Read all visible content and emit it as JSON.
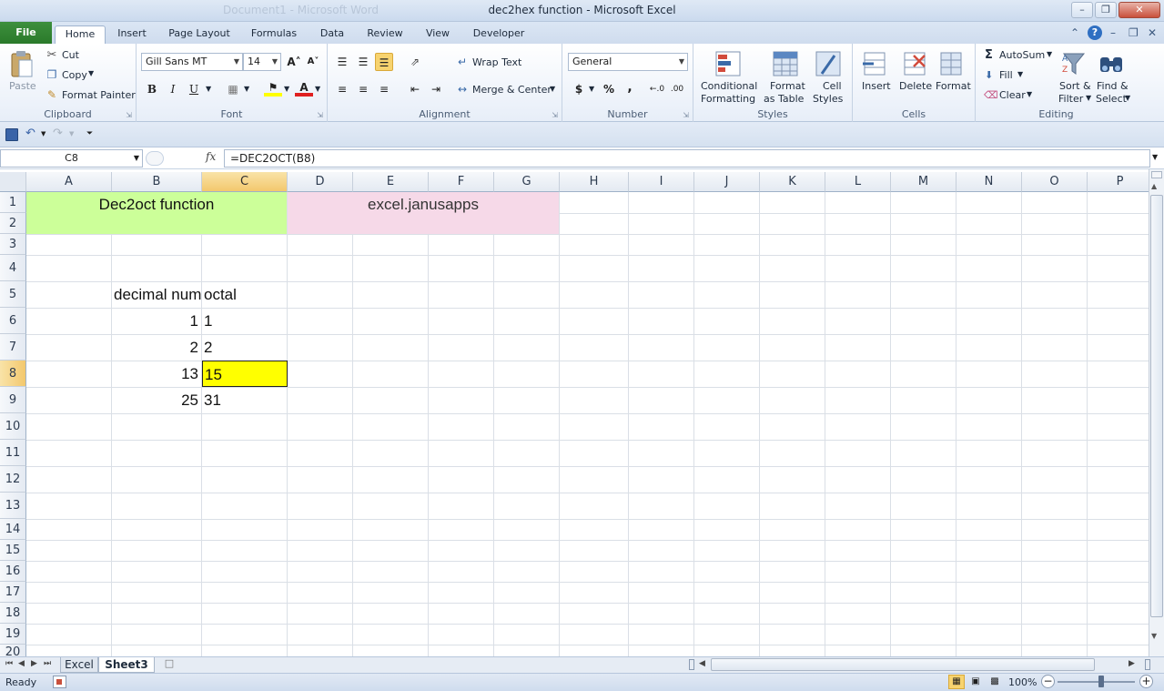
{
  "window": {
    "title": "dec2hex function  -  Microsoft Excel",
    "ghost_title": "Document1 - Microsoft Word",
    "minimize": "–",
    "restore": "❐",
    "close": "✕"
  },
  "tabs": {
    "file": "File",
    "items": [
      "Home",
      "Insert",
      "Page Layout",
      "Formulas",
      "Data",
      "Review",
      "View",
      "Developer"
    ],
    "active": "Home"
  },
  "ribbon": {
    "clipboard": {
      "paste": "Paste",
      "cut": "Cut",
      "copy": "Copy",
      "format_painter": "Format Painter",
      "label": "Clipboard"
    },
    "font": {
      "name": "Gill Sans MT",
      "size": "14",
      "bold": "B",
      "italic": "I",
      "underline": "U",
      "label": "Font",
      "grow": "A˄",
      "shrink": "A˅"
    },
    "alignment": {
      "wrap_text": "Wrap Text",
      "merge_center": "Merge & Center",
      "label": "Alignment"
    },
    "number": {
      "format": "General",
      "currency": "$",
      "percent": "%",
      "comma": ",",
      "label": "Number"
    },
    "styles": {
      "conditional": "Conditional",
      "conditional2": "Formatting",
      "format_as": "Format",
      "format_as2": "as Table",
      "cell_styles": "Cell",
      "cell_styles2": "Styles",
      "label": "Styles"
    },
    "cells": {
      "insert": "Insert",
      "delete": "Delete",
      "format": "Format",
      "label": "Cells"
    },
    "editing": {
      "autosum": "AutoSum",
      "fill": "Fill",
      "clear": "Clear",
      "sort": "Sort &",
      "sort2": "Filter",
      "find": "Find &",
      "find2": "Select",
      "label": "Editing"
    }
  },
  "formula_bar": {
    "name_box": "C8",
    "fx": "fx",
    "formula": "=DEC2OCT(B8)"
  },
  "grid": {
    "columns": [
      "A",
      "B",
      "C",
      "D",
      "E",
      "F",
      "G",
      "H",
      "I",
      "J",
      "K",
      "L",
      "M",
      "N",
      "O",
      "P"
    ],
    "rows": [
      "1",
      "2",
      "3",
      "4",
      "5",
      "6",
      "7",
      "8",
      "9",
      "10",
      "11",
      "12",
      "13",
      "14",
      "15",
      "16",
      "17",
      "18",
      "19",
      "20"
    ],
    "selected_column": "C",
    "selected_row": "8",
    "cells": {
      "title_left": "Dec2oct function",
      "title_right": "excel.janusapps",
      "b5": "decimal num",
      "c5": "octal",
      "b6": "1",
      "c6": "1",
      "b7": "2",
      "c7": "2",
      "b8": "13",
      "c8": "15",
      "b9": "25",
      "c9": "31"
    },
    "colors": {
      "title_left_bg": "#ccff99",
      "title_right_bg": "#f6d9e8",
      "highlight": "#ffff00",
      "selection_header": "#f3c86d"
    }
  },
  "sheets": {
    "items": [
      "Excel",
      "Sheet3"
    ],
    "active": "Sheet3"
  },
  "status": {
    "ready": "Ready",
    "zoom": "100%"
  }
}
